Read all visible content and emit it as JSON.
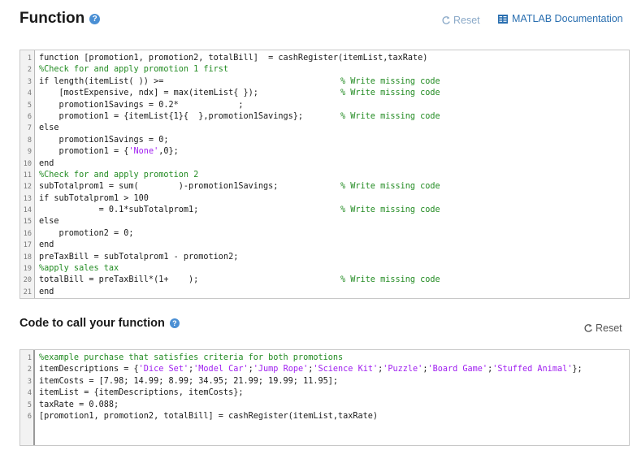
{
  "function_section": {
    "title": "Function",
    "help_icon": "question-circle-icon",
    "reset_label": "Reset",
    "doc_label": "MATLAB Documentation",
    "code_lines": [
      {
        "n": "1",
        "parts": [
          {
            "t": "function [promotion1, promotion2, totalBill]  = cashRegister(itemList,taxRate)",
            "c": ""
          }
        ],
        "missing": ""
      },
      {
        "n": "2",
        "parts": [
          {
            "t": "%Check for and apply promotion 1 first",
            "c": "cmt"
          }
        ],
        "missing": ""
      },
      {
        "n": "3",
        "parts": [
          {
            "t": "if length(itemList( )) >=",
            "c": ""
          }
        ],
        "missing": "% Write missing code"
      },
      {
        "n": "4",
        "parts": [
          {
            "t": "    [mostExpensive, ndx] = max(itemList{ });",
            "c": ""
          }
        ],
        "missing": "% Write missing code"
      },
      {
        "n": "5",
        "parts": [
          {
            "t": "    promotion1Savings = 0.2*            ;",
            "c": ""
          }
        ],
        "missing": ""
      },
      {
        "n": "6",
        "parts": [
          {
            "t": "    promotion1 = {itemList{1}{  },promotion1Savings};",
            "c": ""
          }
        ],
        "missing": "% Write missing code"
      },
      {
        "n": "7",
        "parts": [
          {
            "t": "else",
            "c": ""
          }
        ],
        "missing": ""
      },
      {
        "n": "8",
        "parts": [
          {
            "t": "    promotion1Savings = 0;",
            "c": ""
          }
        ],
        "missing": ""
      },
      {
        "n": "9",
        "parts": [
          {
            "t": "    promotion1 = {",
            "c": ""
          },
          {
            "t": "'None'",
            "c": "str"
          },
          {
            "t": ",0};",
            "c": ""
          }
        ],
        "missing": ""
      },
      {
        "n": "10",
        "parts": [
          {
            "t": "end",
            "c": ""
          }
        ],
        "missing": ""
      },
      {
        "n": "11",
        "parts": [
          {
            "t": "%Check for and apply promotion 2",
            "c": "cmt"
          }
        ],
        "missing": ""
      },
      {
        "n": "12",
        "parts": [
          {
            "t": "subTotalprom1 = sum(        )-promotion1Savings;",
            "c": ""
          }
        ],
        "missing": "% Write missing code"
      },
      {
        "n": "13",
        "parts": [
          {
            "t": "if subTotalprom1 > 100",
            "c": ""
          }
        ],
        "missing": ""
      },
      {
        "n": "14",
        "parts": [
          {
            "t": "            = 0.1*subTotalprom1;",
            "c": ""
          }
        ],
        "missing": "% Write missing code"
      },
      {
        "n": "15",
        "parts": [
          {
            "t": "else",
            "c": ""
          }
        ],
        "missing": ""
      },
      {
        "n": "16",
        "parts": [
          {
            "t": "    promotion2 = 0;",
            "c": ""
          }
        ],
        "missing": ""
      },
      {
        "n": "17",
        "parts": [
          {
            "t": "end",
            "c": ""
          }
        ],
        "missing": ""
      },
      {
        "n": "18",
        "parts": [
          {
            "t": "preTaxBill = subTotalprom1 - promotion2;",
            "c": ""
          }
        ],
        "missing": ""
      },
      {
        "n": "19",
        "parts": [
          {
            "t": "%apply sales tax",
            "c": "cmt"
          }
        ],
        "missing": ""
      },
      {
        "n": "20",
        "parts": [
          {
            "t": "totalBill = preTaxBill*(1+    );",
            "c": ""
          }
        ],
        "missing": "% Write missing code"
      },
      {
        "n": "21",
        "parts": [
          {
            "t": "end",
            "c": ""
          }
        ],
        "missing": ""
      }
    ]
  },
  "call_section": {
    "title": "Code to call your function",
    "help_icon": "question-circle-icon",
    "reset_label": "Reset",
    "code_lines": [
      {
        "n": "1",
        "parts": [
          {
            "t": "%example purchase that satisfies criteria for both promotions",
            "c": "cmt"
          }
        ],
        "missing": ""
      },
      {
        "n": "2",
        "parts": [
          {
            "t": "itemDescriptions = {",
            "c": ""
          },
          {
            "t": "'Dice Set'",
            "c": "str"
          },
          {
            "t": ";",
            "c": ""
          },
          {
            "t": "'Model Car'",
            "c": "str"
          },
          {
            "t": ";",
            "c": ""
          },
          {
            "t": "'Jump Rope'",
            "c": "str"
          },
          {
            "t": ";",
            "c": ""
          },
          {
            "t": "'Science Kit'",
            "c": "str"
          },
          {
            "t": ";",
            "c": ""
          },
          {
            "t": "'Puzzle'",
            "c": "str"
          },
          {
            "t": ";",
            "c": ""
          },
          {
            "t": "'Board Game'",
            "c": "str"
          },
          {
            "t": ";",
            "c": ""
          },
          {
            "t": "'Stuffed Animal'",
            "c": "str"
          },
          {
            "t": "};",
            "c": ""
          }
        ],
        "missing": ""
      },
      {
        "n": "3",
        "parts": [
          {
            "t": "itemCosts = [7.98; 14.99; 8.99; 34.95; 21.99; 19.99; 11.95];",
            "c": ""
          }
        ],
        "missing": ""
      },
      {
        "n": "4",
        "parts": [
          {
            "t": "itemList = {itemDescriptions, itemCosts};",
            "c": ""
          }
        ],
        "missing": ""
      },
      {
        "n": "5",
        "parts": [
          {
            "t": "taxRate = 0.088;",
            "c": ""
          }
        ],
        "missing": ""
      },
      {
        "n": "6",
        "parts": [
          {
            "t": "[promotion1, promotion2, totalBill] = cashRegister(itemList,taxRate)",
            "c": ""
          }
        ],
        "missing": ""
      }
    ]
  },
  "colors": {
    "comment": "#228b22",
    "string": "#a020f0",
    "link": "#2a6fb0",
    "help": "#4a8fd4"
  }
}
